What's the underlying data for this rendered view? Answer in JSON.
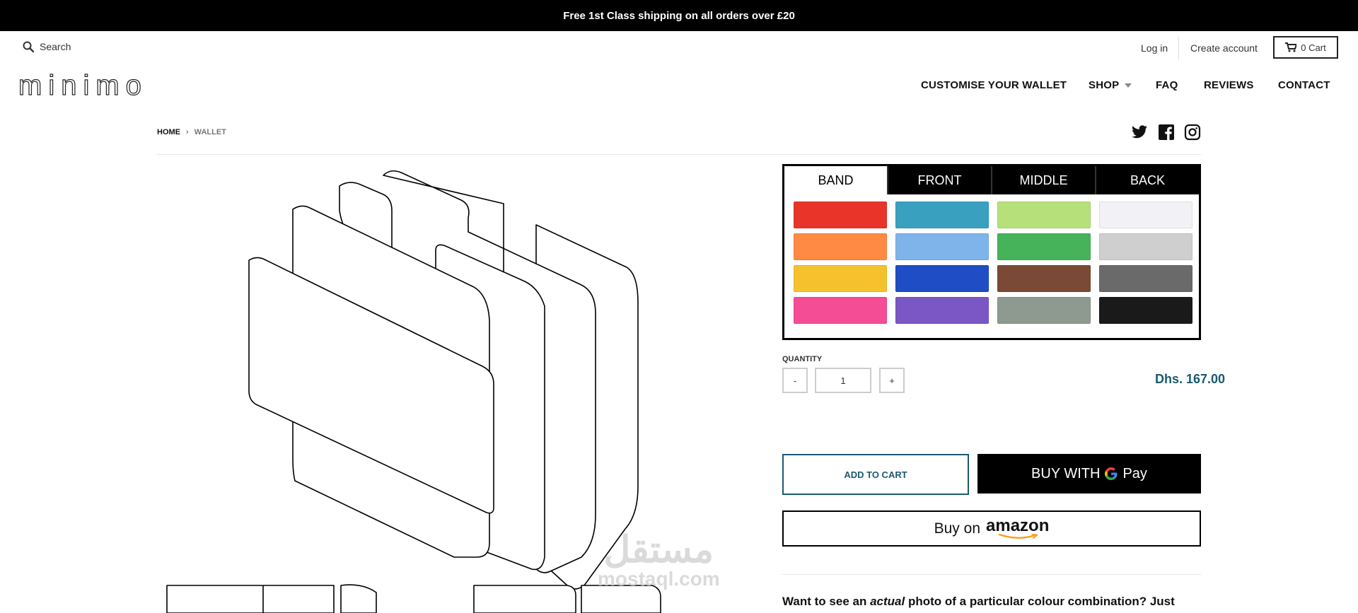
{
  "announcement": "Free 1st Class shipping on all orders over £20",
  "header": {
    "search_label": "Search",
    "login": "Log in",
    "create_account": "Create account",
    "cart_label": "0 Cart",
    "logo": "minimo"
  },
  "nav": {
    "items": [
      "CUSTOMISE YOUR WALLET",
      "SHOP",
      "FAQ",
      "REVIEWS",
      "CONTACT"
    ]
  },
  "breadcrumb": {
    "home": "HOME",
    "separator": "›",
    "current": "WALLET"
  },
  "social": {
    "icons": [
      "twitter-icon",
      "facebook-icon",
      "instagram-icon"
    ]
  },
  "configurator": {
    "tabs": [
      "BAND",
      "FRONT",
      "MIDDLE",
      "BACK"
    ],
    "active_tab": "BAND",
    "swatches": [
      [
        "#e9342a",
        "#3aa0c0",
        "#b6e07a",
        "#f1f1f6"
      ],
      [
        "#ff8a43",
        "#7eb4ea",
        "#46b35a",
        "#cfcfcf"
      ],
      [
        "#f5c22e",
        "#1f4dc5",
        "#7a4a36",
        "#6a6a6a"
      ],
      [
        "#f54c96",
        "#7b57c6",
        "#8e9a90",
        "#1a1a1a"
      ]
    ]
  },
  "quantity": {
    "label": "QUANTITY",
    "minus": "-",
    "value": "1",
    "plus": "+"
  },
  "price": "Dhs. 167.00",
  "buttons": {
    "add_to_cart": "ADD TO CART",
    "gpay_prefix": "BUY WITH",
    "gpay_suffix": "Pay",
    "amazon_prefix": "Buy on",
    "amazon_brand": "amazon"
  },
  "promo": {
    "pre": "Want to see an",
    "em": "actual",
    "post": "photo of a particular colour combination? Just"
  },
  "watermark": {
    "arabic": "مستقل",
    "latin": "mostaql.com"
  },
  "colors": {
    "accent": "#1a5a6e",
    "black": "#000000"
  }
}
